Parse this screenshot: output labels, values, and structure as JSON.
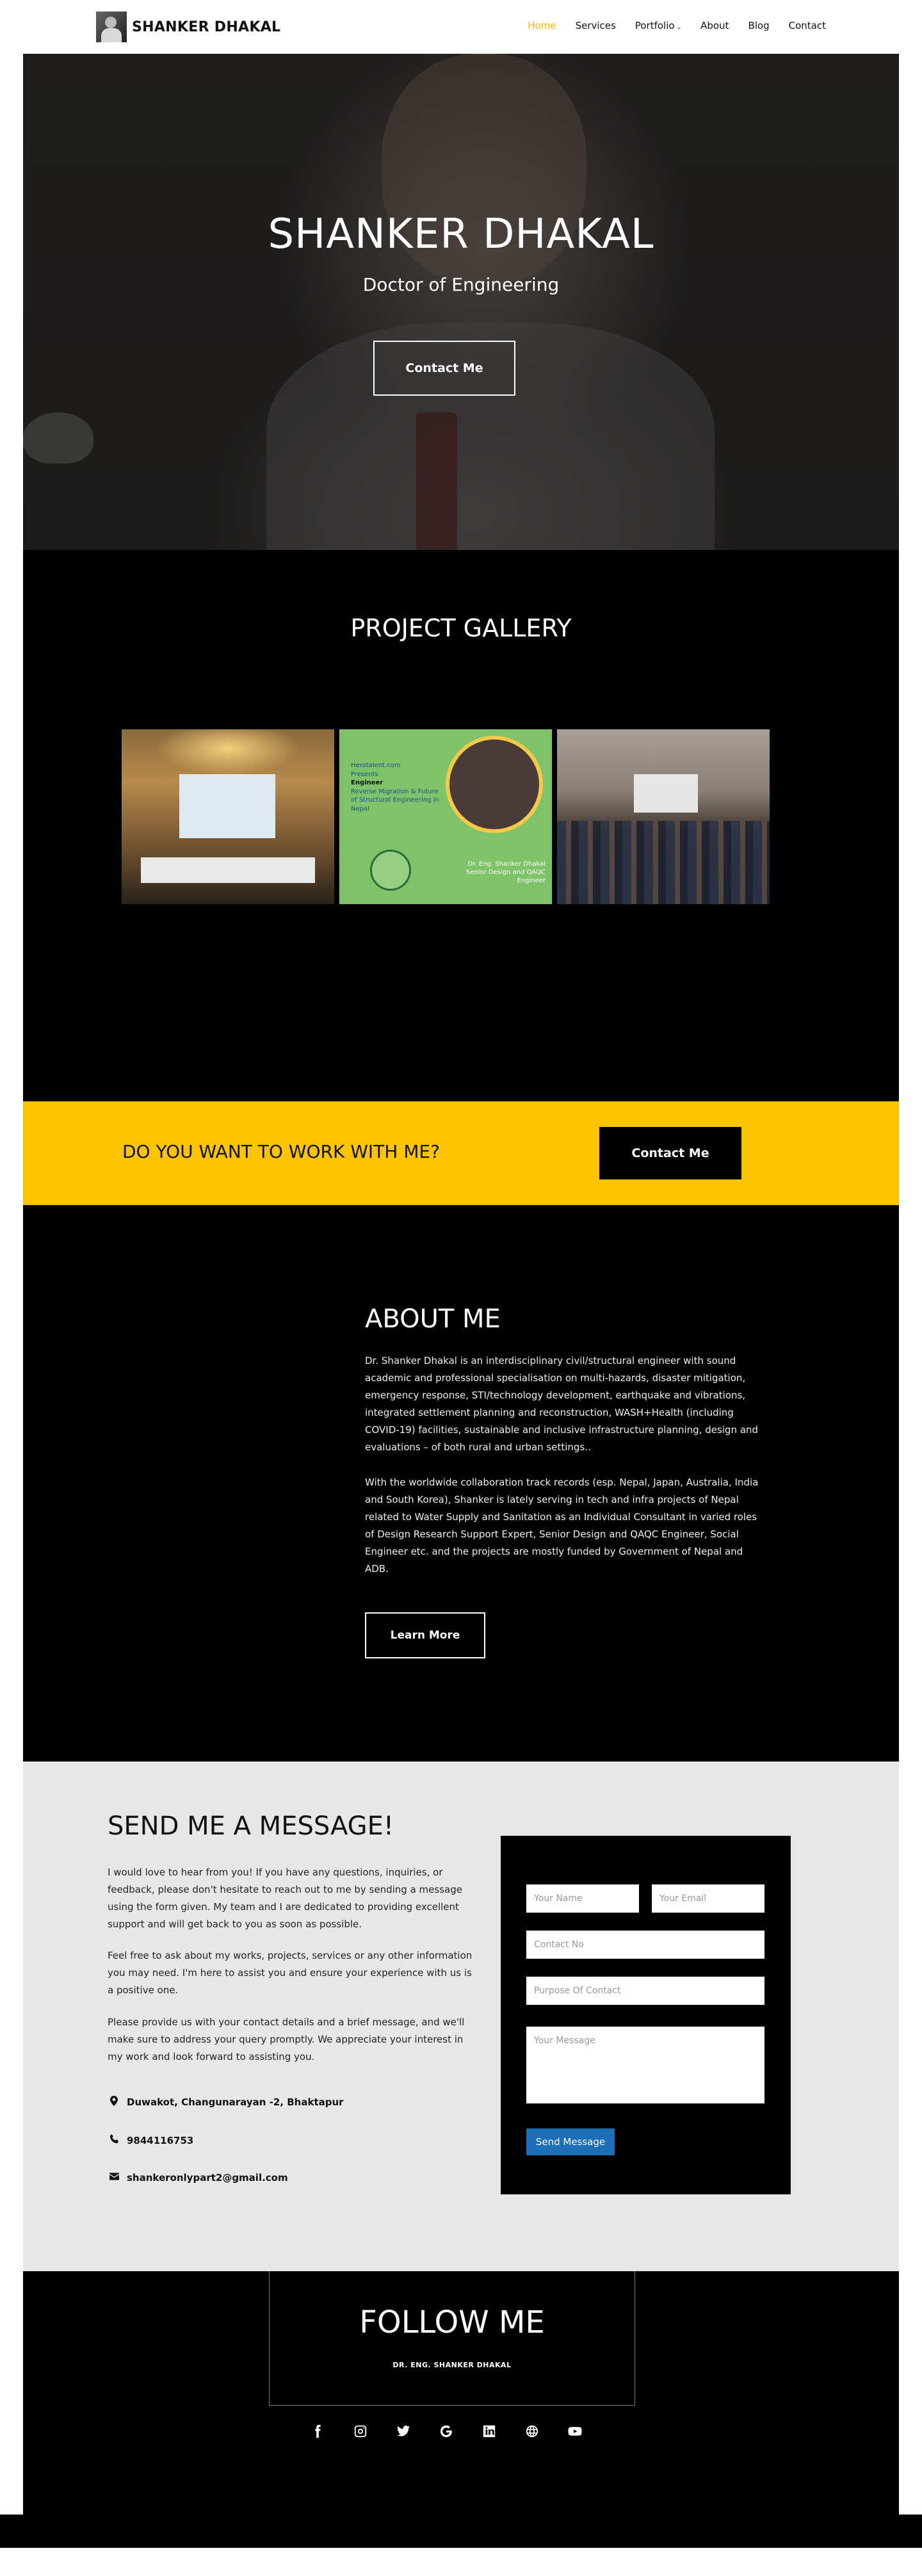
{
  "header": {
    "logo_text": "SHANKER DHAKAL",
    "nav": [
      {
        "label": "Home",
        "active": true
      },
      {
        "label": "Services"
      },
      {
        "label": "Portfolio",
        "has_dropdown": true
      },
      {
        "label": "About"
      },
      {
        "label": "Blog"
      },
      {
        "label": "Contact"
      }
    ],
    "active_color": "#f5b800"
  },
  "hero": {
    "title": "SHANKER DHAKAL",
    "subtitle": "Doctor of Engineering",
    "button": "Contact Me"
  },
  "gallery": {
    "title": "PROJECT GALLERY",
    "images": [
      {
        "icon": "conference-photo"
      },
      {
        "icon": "event-poster",
        "poster_lines": [
          "Herotalent.com",
          "Presents",
          "Engineer",
          "Reverse Migration & Future of Structural Engineering in Nepal"
        ],
        "caption": [
          "Dr. Eng. Shanker Dhakal",
          "Senior Design and QAQC Engineer"
        ]
      },
      {
        "icon": "group-photo"
      }
    ]
  },
  "cta": {
    "text": "DO YOU WANT TO WORK WITH ME?",
    "button": "Contact Me",
    "bg_color": "#ffc400"
  },
  "about": {
    "title": "ABOUT ME",
    "paragraph1": "Dr. Shanker Dhakal is an interdisciplinary civil/structural engineer with sound academic and professional specialisation on multi-hazards, disaster mitigation, emergency response, STI/technology development, earthquake and vibrations, integrated settlement planning and reconstruction, WASH+Health (including COVID-19) facilities, sustainable and inclusive infrastructure planning, design and evaluations – of both rural and urban settings..",
    "paragraph2": "With the worldwide collaboration track records (esp. Nepal, Japan, Australia, India and South Korea), Shanker is lately serving in tech and infra projects of Nepal related to Water Supply and Sanitation as an Individual Consultant in varied roles of Design Research Support Expert, Senior Design and QAQC Engineer, Social Engineer etc. and the projects are mostly funded by Government of Nepal and ADB.",
    "button": "Learn More"
  },
  "contact": {
    "title": "SEND ME A MESSAGE!",
    "paragraph1": "I would love to hear from you! If you have any questions, inquiries, or feedback, please don't hesitate to reach out to me by sending a message using the form given. My team and I are dedicated to providing excellent support and will get back to you as soon as possible.",
    "paragraph2": "Feel free to ask about my works, projects, services or any other information you may need. I'm here to assist you and ensure your experience with us is a positive one.",
    "paragraph3": "Please provide us with your contact details and a brief message, and we'll make sure to address your query promptly. We appreciate your interest in my work and look forward to assisting you.",
    "address": "Duwakot, Changunarayan -2, Bhaktapur",
    "phone": "9844116753",
    "email": "shankeronlypart2@gmail.com",
    "form": {
      "name_placeholder": "Your Name",
      "email_placeholder": "Your Email",
      "phone_placeholder": "Contact No",
      "purpose_placeholder": "Purpose Of Contact",
      "message_placeholder": "Your Message",
      "submit": "Send Message",
      "submit_color": "#1c6fb6"
    }
  },
  "follow": {
    "title": "FOLLOW ME",
    "subtitle": "DR. ENG. SHANKER DHAKAL",
    "socials": [
      {
        "name": "facebook-icon"
      },
      {
        "name": "instagram-icon"
      },
      {
        "name": "twitter-icon"
      },
      {
        "name": "google-icon"
      },
      {
        "name": "linkedin-icon"
      },
      {
        "name": "website-icon"
      },
      {
        "name": "youtube-icon"
      }
    ]
  }
}
